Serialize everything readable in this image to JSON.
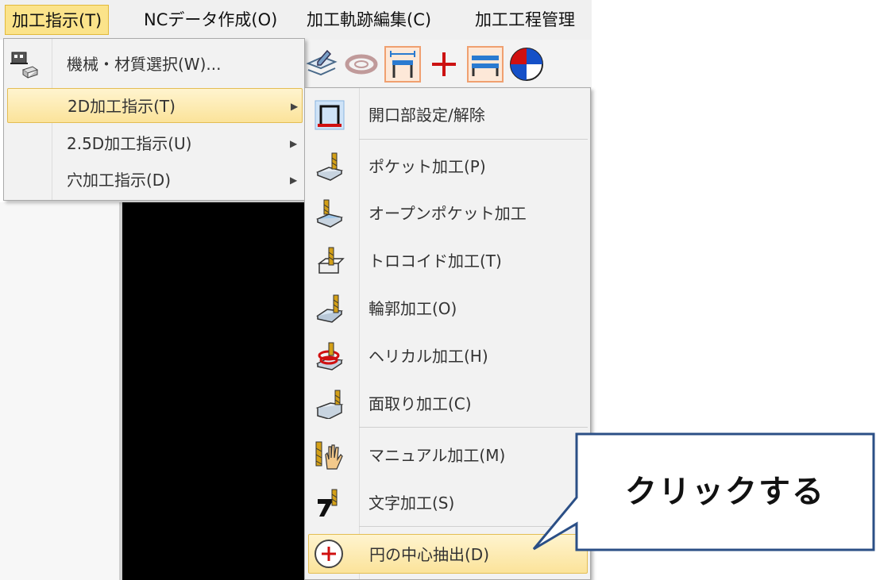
{
  "menubar": {
    "items": [
      {
        "label": "加工指示(T)"
      },
      {
        "label": "NCデータ作成(O)"
      },
      {
        "label": "加工軌跡編集(C)"
      },
      {
        "label": "加工工程管理"
      }
    ]
  },
  "menu1": {
    "items": [
      {
        "label": "機械・材質選択(W)...",
        "icon": "machine-material-icon"
      },
      {
        "label": "2D加工指示(T)",
        "submenu": true
      },
      {
        "label": "2.5D加工指示(U)",
        "submenu": true
      },
      {
        "label": "穴加工指示(D)",
        "submenu": true
      }
    ]
  },
  "menu2": {
    "items": [
      {
        "label": "開口部設定/解除",
        "icon": "opening-setting-icon"
      },
      {
        "label": "ポケット加工(P)",
        "icon": "pocket-icon"
      },
      {
        "label": "オープンポケット加工",
        "icon": "open-pocket-icon"
      },
      {
        "label": "トロコイド加工(T)",
        "icon": "trochoid-icon"
      },
      {
        "label": "輪郭加工(O)",
        "icon": "contour-icon"
      },
      {
        "label": "ヘリカル加工(H)",
        "icon": "helical-icon"
      },
      {
        "label": "面取り加工(C)",
        "icon": "chamfer-icon"
      },
      {
        "label": "マニュアル加工(M)",
        "icon": "manual-hand-icon"
      },
      {
        "label": "文字加工(S)",
        "icon": "text-engrave-icon"
      },
      {
        "label": "円の中心抽出(D)",
        "icon": "circle-center-icon"
      }
    ]
  },
  "callout": {
    "text": "クリックする"
  },
  "colors": {
    "highlight": "#fbe39a",
    "accent_red": "#cc0000",
    "accent_blue": "#1e6fd0",
    "gold": "#d4a017"
  }
}
